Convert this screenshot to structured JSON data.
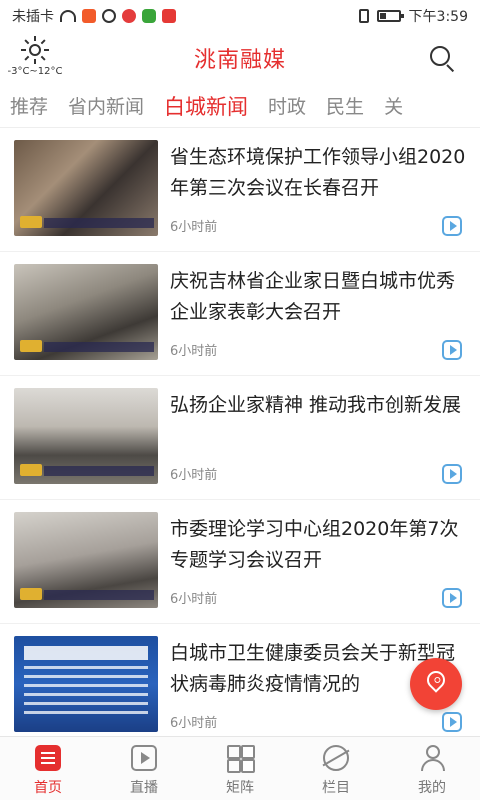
{
  "status_bar": {
    "carrier": "未插卡",
    "time": "下午3:59"
  },
  "header": {
    "weather_icon": "sun-icon",
    "temperature": "-3°C~12°C",
    "title": "洮南融媒",
    "search_icon": "search-icon"
  },
  "tabs": [
    {
      "label": "推荐",
      "active": false
    },
    {
      "label": "省内新闻",
      "active": false
    },
    {
      "label": "白城新闻",
      "active": true
    },
    {
      "label": "时政",
      "active": false
    },
    {
      "label": "民生",
      "active": false
    },
    {
      "label": "关",
      "active": false
    }
  ],
  "news": [
    {
      "title": "省生态环境保护工作领导小组2020年第三次会议在长春召开",
      "time": "6小时前",
      "icon": "video-icon"
    },
    {
      "title": "庆祝吉林省企业家日暨白城市优秀企业家表彰大会召开",
      "time": "6小时前",
      "icon": "video-icon"
    },
    {
      "title": "弘扬企业家精神 推动我市创新发展",
      "time": "6小时前",
      "icon": "video-icon"
    },
    {
      "title": "市委理论学习中心组2020年第7次专题学习会议召开",
      "time": "6小时前",
      "icon": "video-icon"
    },
    {
      "title": "白城市卫生健康委员会关于新型冠状病毒肺炎疫情情况的",
      "time": "6小时前",
      "icon": "video-icon"
    }
  ],
  "floating_button": {
    "icon": "location-pin-icon"
  },
  "bottom_nav": [
    {
      "label": "首页",
      "icon": "home-icon",
      "active": true
    },
    {
      "label": "直播",
      "icon": "live-icon",
      "active": false
    },
    {
      "label": "矩阵",
      "icon": "matrix-icon",
      "active": false
    },
    {
      "label": "栏目",
      "icon": "column-icon",
      "active": false
    },
    {
      "label": "我的",
      "icon": "profile-icon",
      "active": false
    }
  ],
  "colors": {
    "brand": "#e52f2f",
    "float_button": "#f24336",
    "video_icon": "#5aa7e0"
  }
}
